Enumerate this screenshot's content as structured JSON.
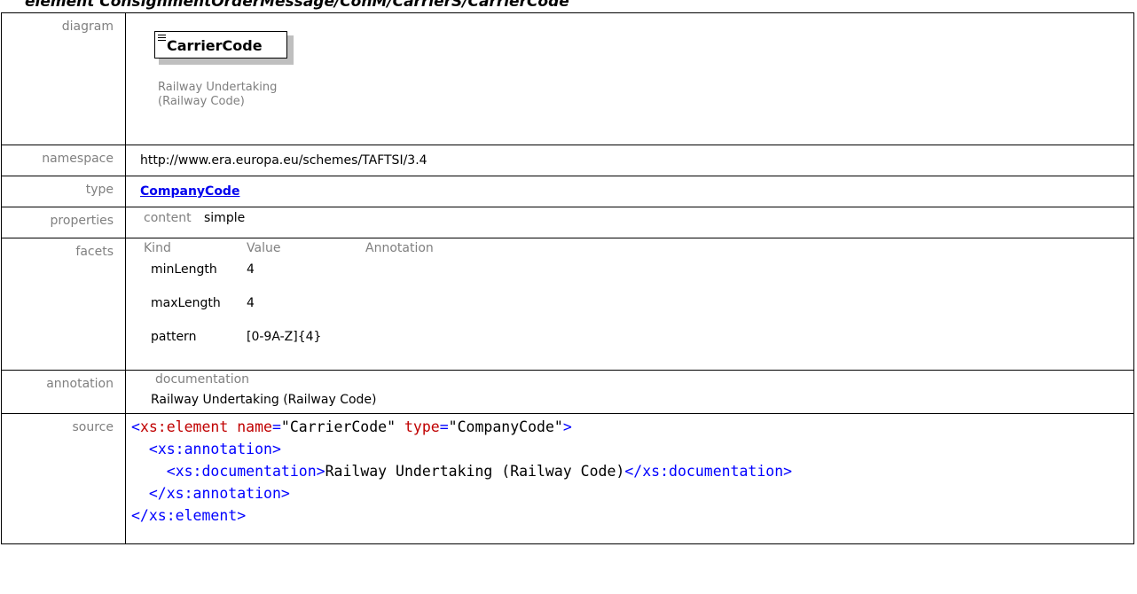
{
  "heading": "element ConsignmentOrderMessage/ConM/CarrierS/CarrierCode",
  "rows": {
    "diagram": {
      "label": "diagram",
      "node_name": "CarrierCode",
      "annotation_line1": "Railway Undertaking",
      "annotation_line2": "(Railway Code)"
    },
    "namespace": {
      "label": "namespace",
      "value": "http://www.era.europa.eu/schemes/TAFTSI/3.4"
    },
    "type": {
      "label": "type",
      "value": "CompanyCode"
    },
    "properties": {
      "label": "properties",
      "key": "content",
      "value": "simple"
    },
    "facets": {
      "label": "facets",
      "headers": [
        "Kind",
        "Value",
        "Annotation"
      ],
      "items": [
        {
          "kind": "minLength",
          "value": "4"
        },
        {
          "kind": "maxLength",
          "value": "4"
        },
        {
          "kind": "pattern",
          "value": "[0-9A-Z]{4}"
        }
      ]
    },
    "annotation": {
      "label": "annotation",
      "header": "documentation",
      "text": "Railway Undertaking (Railway Code)"
    },
    "source": {
      "label": "source",
      "element_tag": "xs:element",
      "attr_name": "name",
      "attr_name_value": "\"CarrierCode\"",
      "attr_type": "type",
      "attr_type_value": "\"CompanyCode\"",
      "annotation_tag": "xs:annotation",
      "documentation_tag": "xs:documentation",
      "documentation_text": "Railway Undertaking (Railway Code)"
    }
  },
  "colors": {
    "label": "#808080",
    "link": "#0000ee",
    "xml_tag": "#0000ff",
    "xml_attr": "#c00000"
  }
}
